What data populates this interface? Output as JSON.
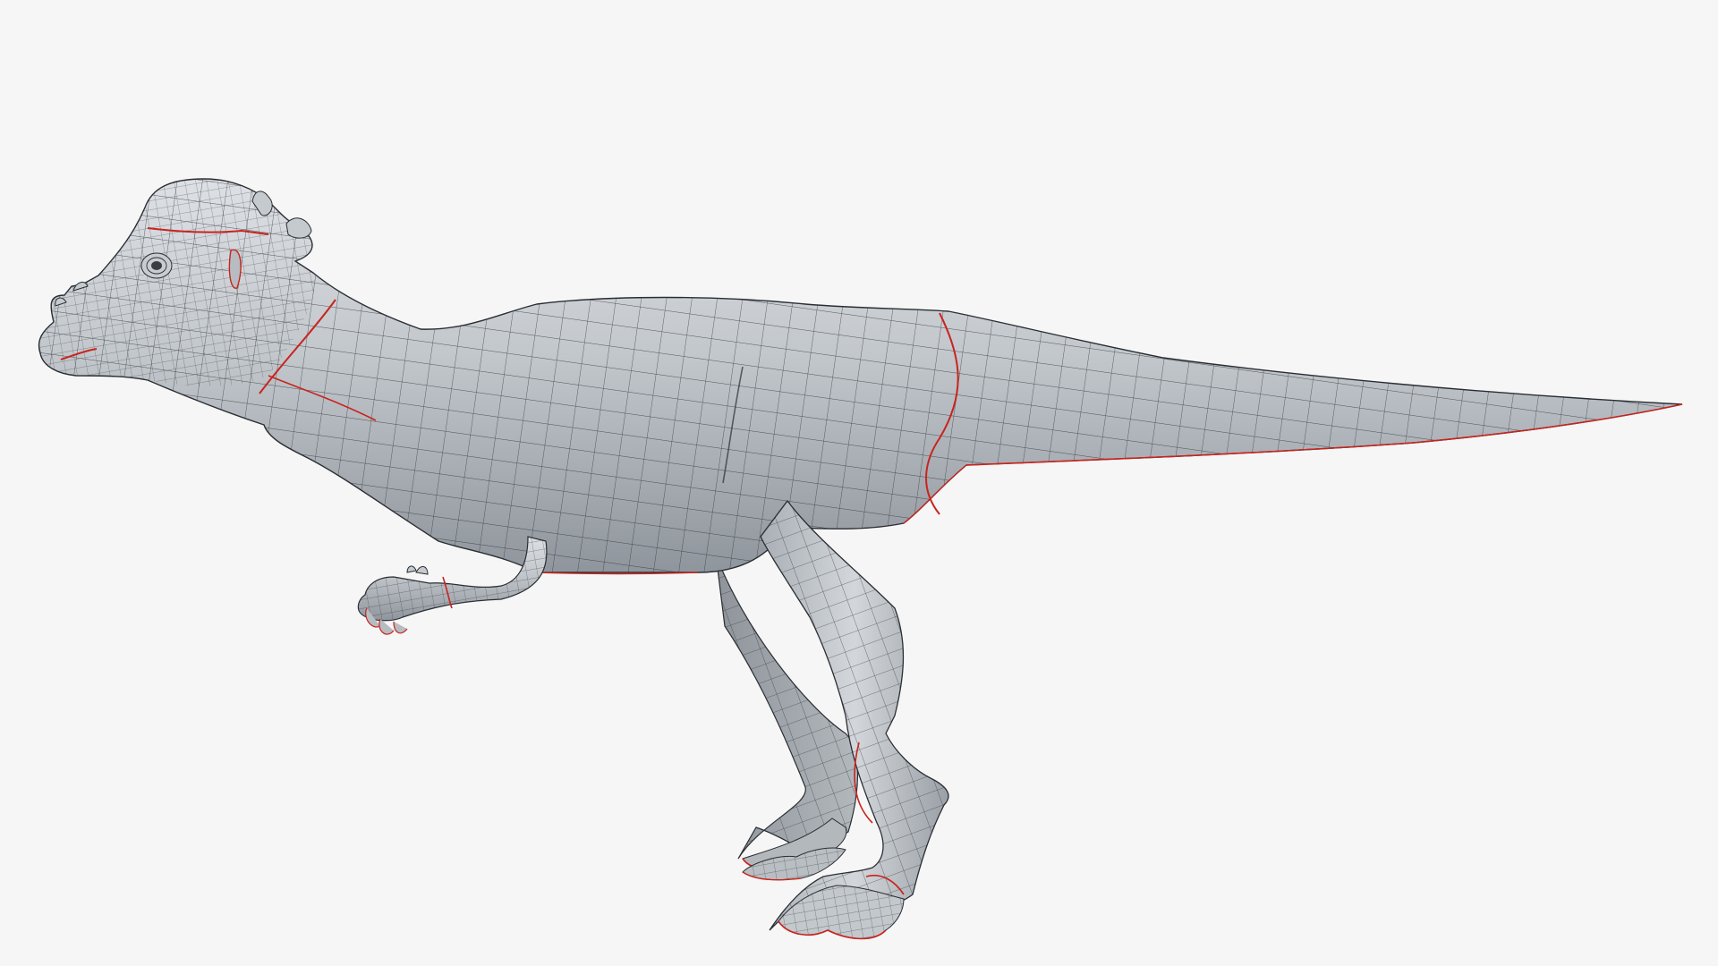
{
  "viewport": {
    "background": "#f6f6f6",
    "subject": "dinosaur-wireframe-model"
  },
  "model": {
    "surface_color": "#b9bec4",
    "highlight_color": "#dcdfe3",
    "shadow_color": "#8d939a",
    "wire_color": "#2a2e33",
    "seam_color": "#c8241e"
  }
}
